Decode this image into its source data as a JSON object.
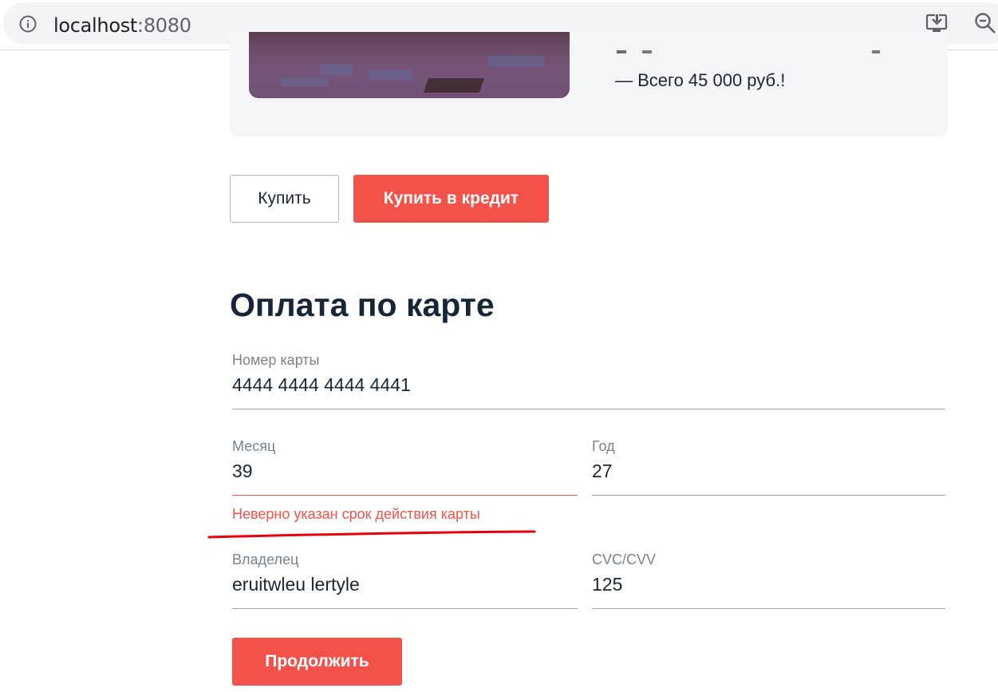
{
  "browser": {
    "url_host": "localhost",
    "url_port": ":8080",
    "icons": [
      "info-icon",
      "install-icon",
      "zoom-out-icon"
    ]
  },
  "product": {
    "total": "—  Всего 45 000 руб.!"
  },
  "actions": {
    "buy_label": "Купить",
    "credit_label": "Купить в кредит"
  },
  "payment": {
    "title": "Оплата по карте",
    "card_number": {
      "label": "Номер карты",
      "value": "4444 4444 4444 4441"
    },
    "month": {
      "label": "Месяц",
      "value": "39"
    },
    "year": {
      "label": "Год",
      "value": "27"
    },
    "month_error": "Неверно указан срок действия карты",
    "owner": {
      "label": "Владелец",
      "value": "eruitwleu lertyle"
    },
    "cvc": {
      "label": "CVC/CVV",
      "value": "125"
    },
    "continue_label": "Продолжить"
  },
  "colors": {
    "accent": "#f2524a",
    "text": "#1b2533",
    "muted": "#7a818b",
    "annotation": "#e8000a"
  }
}
